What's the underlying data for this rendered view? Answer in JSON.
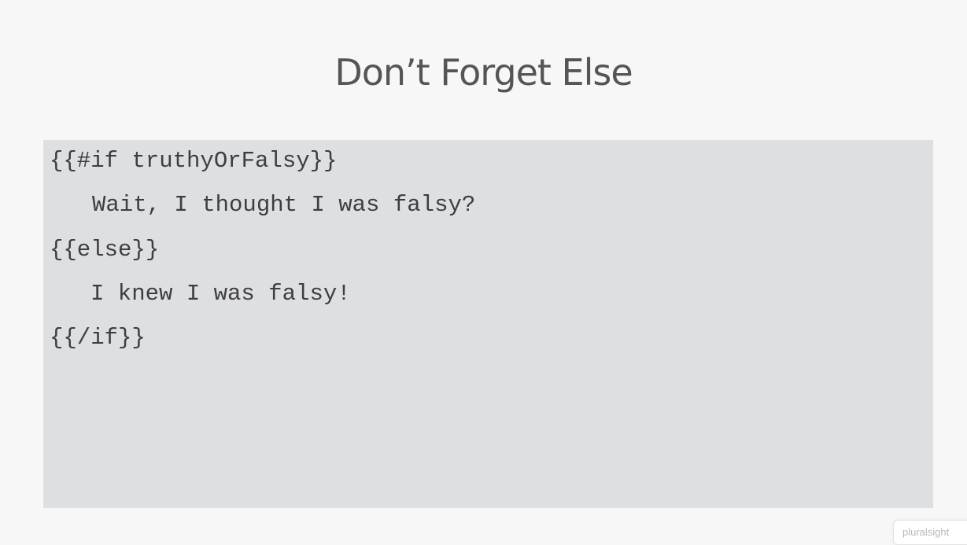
{
  "slide": {
    "title": "Don’t Forget Else"
  },
  "code": {
    "lines": [
      "{{#if truthyOrFalsy}}",
      "Wait, I thought I was falsy?",
      "{{else}}",
      "I knew I was falsy!",
      "{{/if}}"
    ]
  },
  "watermark": {
    "label": "pluralsight"
  }
}
